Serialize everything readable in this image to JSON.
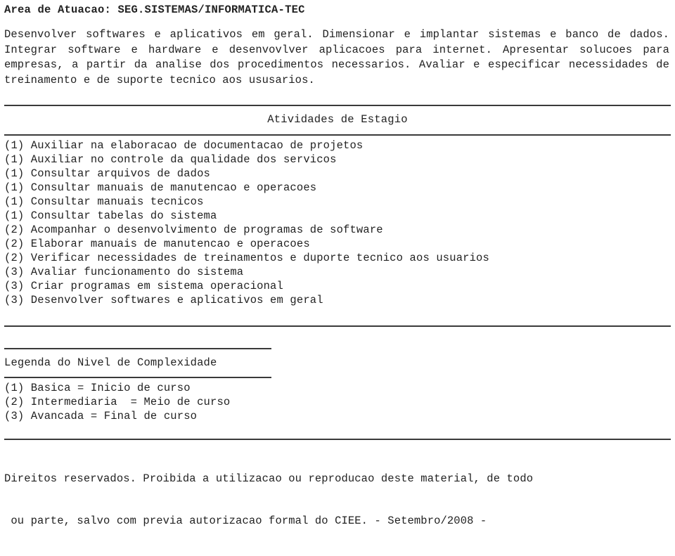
{
  "header": {
    "label": "Area de Atuacao:",
    "value": "SEG.SISTEMAS/INFORMATICA-TEC",
    "full_line": "Area de Atuacao: SEG.SISTEMAS/INFORMATICA-TEC"
  },
  "intro": {
    "paragraph": "Desenvolver  softwares e aplicativos em geral. Dimensionar e implantar sistemas e  banco  de dados. Integrar software e hardware e desenvovlver aplicacoes para internet.  Apresentar  solucoes para empresas, a partir da analise dos procedimentos  necessarios. Avaliar e especificar necessidades de treinamento e de suporte tecnico aos ususarios."
  },
  "activities": {
    "title": "Atividades de Estagio",
    "items": [
      "(1) Auxiliar na elaboracao de documentacao de projetos",
      "(1) Auxiliar no controle da qualidade dos servicos",
      "(1) Consultar arquivos de dados",
      "(1) Consultar manuais de manutencao e operacoes",
      "(1) Consultar manuais tecnicos",
      "(1) Consultar tabelas do sistema",
      "(2) Acompanhar o desenvolvimento de programas de software",
      "(2) Elaborar manuais de manutencao e operacoes",
      "(2) Verificar necessidades de treinamentos e duporte tecnico aos usuarios",
      "(3) Avaliar funcionamento do sistema",
      "(3) Criar programas em sistema operacional",
      "(3) Desenvolver softwares e aplicativos em geral"
    ]
  },
  "legend": {
    "title": "Legenda do Nivel de Complexidade",
    "items": [
      "(1) Basica = Inicio de curso",
      "(2) Intermediaria  = Meio de curso",
      "(3) Avancada = Final de curso"
    ]
  },
  "footer": {
    "line1": "Direitos reservados. Proibida a utilizacao ou reproducao deste material, de todo",
    "line2": " ou parte, salvo com previa autorizacao formal do CIEE. - Setembro/2008 -"
  },
  "colors": {
    "text": "#222222",
    "rule": "#3a3a3a",
    "background": "#ffffff"
  }
}
